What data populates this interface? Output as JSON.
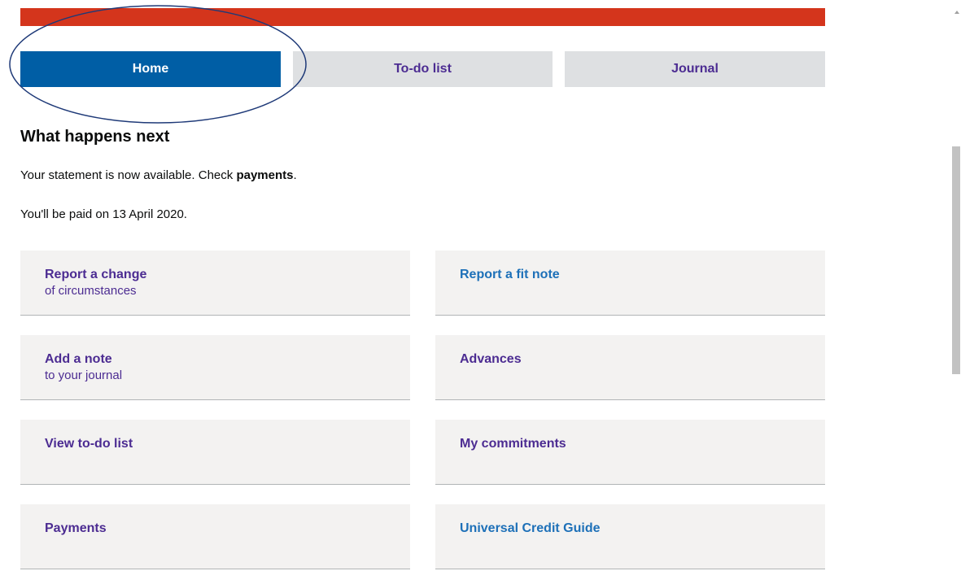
{
  "nav": {
    "tabs": [
      {
        "label": "Home",
        "active": true
      },
      {
        "label": "To-do list",
        "active": false
      },
      {
        "label": "Journal",
        "active": false
      }
    ]
  },
  "main": {
    "heading": "What happens next",
    "statement_text": "Your statement is now available. Check ",
    "statement_link": "payments",
    "statement_end": ".",
    "payment_date_text": "You'll be paid on 13 April 2020."
  },
  "cards": {
    "report_change": {
      "title": "Report a change",
      "subtitle": "of circumstances"
    },
    "report_fit_note": {
      "title": "Report a fit note"
    },
    "add_note": {
      "title": "Add a note",
      "subtitle": "to your journal"
    },
    "advances": {
      "title": "Advances"
    },
    "view_todo": {
      "title": "View to-do list"
    },
    "my_commitments": {
      "title": "My commitments"
    },
    "payments": {
      "title": "Payments"
    },
    "uc_guide": {
      "title": "Universal Credit Guide"
    }
  },
  "colors": {
    "banner": "#d4351c",
    "active_tab": "#005ea5",
    "inactive_tab": "#dee0e2",
    "link_purple": "#4c2c92",
    "link_blue": "#1d70b8",
    "card_bg": "#f3f2f1",
    "annotation": "#1f3a78"
  }
}
